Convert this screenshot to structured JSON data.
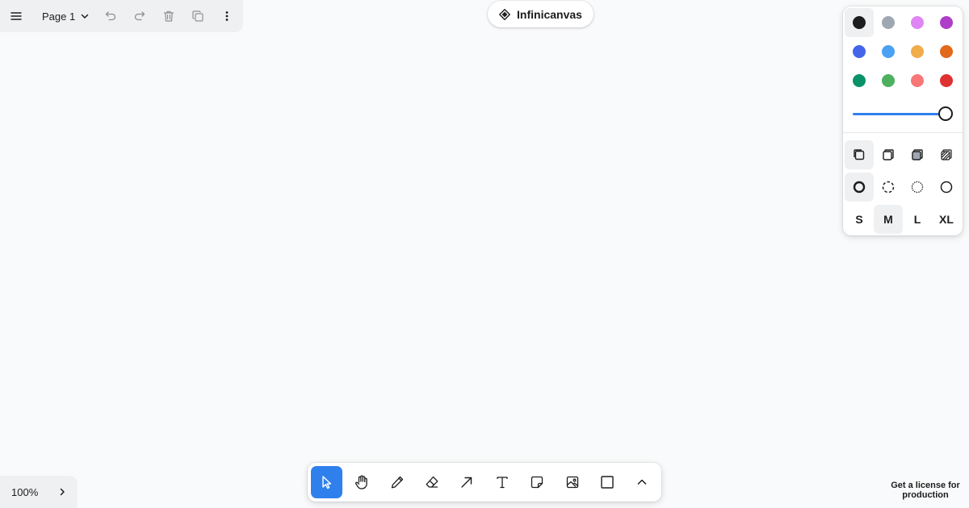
{
  "menu": {
    "page_label": "Page 1",
    "icons": [
      "menu-icon",
      "chevron-down-icon",
      "undo-icon",
      "redo-icon",
      "trash-icon",
      "duplicate-icon",
      "more-icon"
    ]
  },
  "brand": {
    "name": "Infinicanvas",
    "icon": "diamond-icon"
  },
  "style_panel": {
    "colors": [
      {
        "name": "black",
        "hex": "#1d1d1d",
        "selected": true
      },
      {
        "name": "grey",
        "hex": "#9fa8b2"
      },
      {
        "name": "light-violet",
        "hex": "#e085f4"
      },
      {
        "name": "violet",
        "hex": "#ae3ec9"
      },
      {
        "name": "blue",
        "hex": "#4465e9"
      },
      {
        "name": "light-blue",
        "hex": "#4ba1f1"
      },
      {
        "name": "yellow",
        "hex": "#f1ac4b"
      },
      {
        "name": "orange",
        "hex": "#e16919"
      },
      {
        "name": "green",
        "hex": "#099268"
      },
      {
        "name": "light-green",
        "hex": "#4cb05e"
      },
      {
        "name": "light-red",
        "hex": "#f87777"
      },
      {
        "name": "red",
        "hex": "#e03131"
      }
    ],
    "opacity": 1.0,
    "fill_icons": [
      "fill-none-icon",
      "fill-semi-icon",
      "fill-solid-icon",
      "fill-pattern-icon"
    ],
    "dash_icons": [
      "dash-draw-icon",
      "dash-dashed-icon",
      "dash-dotted-icon",
      "dash-solid-icon"
    ],
    "sizes": [
      "S",
      "M",
      "L",
      "XL"
    ],
    "selected_size": "M"
  },
  "toolbar": {
    "tools": [
      "select-icon",
      "hand-icon",
      "draw-icon",
      "eraser-icon",
      "arrow-icon",
      "text-icon",
      "note-icon",
      "image-icon",
      "rectangle-icon",
      "chevron-up-icon"
    ],
    "selected_tool": "select-icon",
    "accent": "#2f80ed"
  },
  "zoom": {
    "value": "100%"
  },
  "license": {
    "text": "Get a license for production"
  }
}
